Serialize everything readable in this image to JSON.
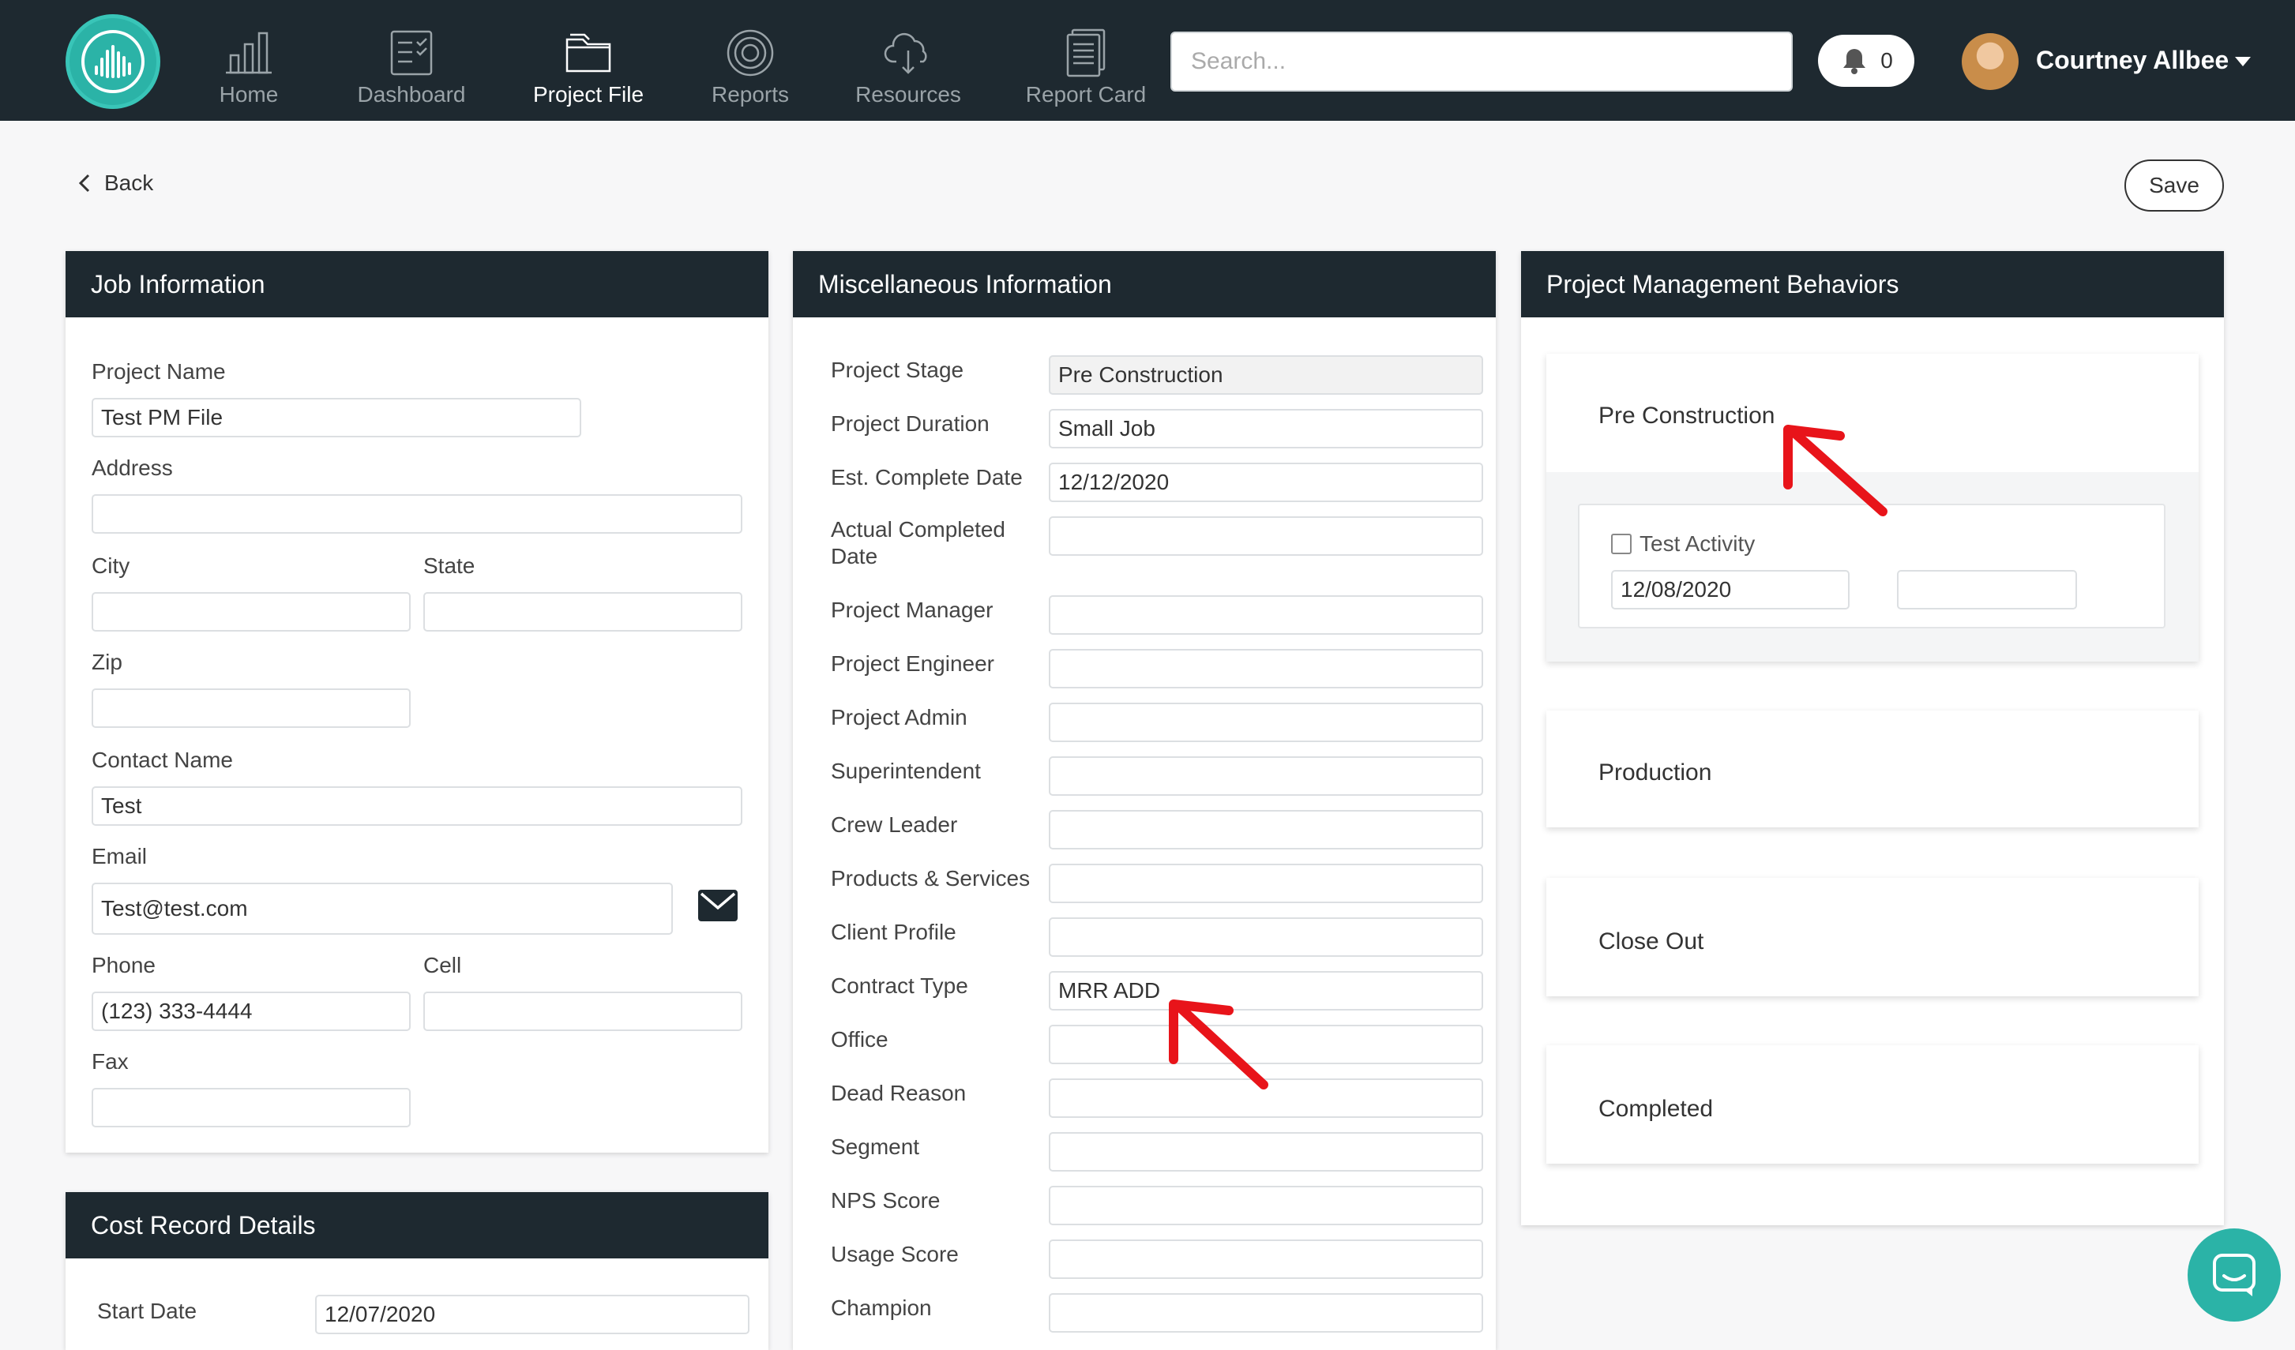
{
  "nav": {
    "items": [
      {
        "label": "Home",
        "icon": "bar-chart-icon"
      },
      {
        "label": "Dashboard",
        "icon": "clipboard-icon"
      },
      {
        "label": "Project File",
        "icon": "folder-icon"
      },
      {
        "label": "Reports",
        "icon": "target-icon"
      },
      {
        "label": "Resources",
        "icon": "cloud-download-icon"
      },
      {
        "label": "Report Card",
        "icon": "document-icon"
      }
    ],
    "active": "Project File",
    "search_placeholder": "Search...",
    "notifications_count": "0",
    "user_name": "Courtney Allbee"
  },
  "toolbar": {
    "back_label": "Back",
    "save_label": "Save"
  },
  "job_information": {
    "title": "Job Information",
    "project_name_label": "Project Name",
    "project_name_value": "Test PM File",
    "address_label": "Address",
    "address_value": "",
    "city_label": "City",
    "city_value": "",
    "state_label": "State",
    "state_value": "",
    "zip_label": "Zip",
    "zip_value": "",
    "contact_name_label": "Contact Name",
    "contact_name_value": "Test",
    "email_label": "Email",
    "email_value": "Test@test.com",
    "phone_label": "Phone",
    "phone_value": "(123) 333-4444",
    "cell_label": "Cell",
    "cell_value": "",
    "fax_label": "Fax",
    "fax_value": ""
  },
  "cost_record": {
    "title": "Cost Record Details",
    "start_date_label": "Start Date",
    "start_date_value": "12/07/2020"
  },
  "misc_information": {
    "title": "Miscellaneous Information",
    "fields": [
      {
        "label": "Project Stage",
        "value": "Pre Construction"
      },
      {
        "label": "Project Duration",
        "value": "Small Job"
      },
      {
        "label": "Est. Complete Date",
        "value": "12/12/2020"
      },
      {
        "label": "Actual Completed Date",
        "value": ""
      },
      {
        "label": "Project Manager",
        "value": ""
      },
      {
        "label": "Project Engineer",
        "value": ""
      },
      {
        "label": "Project Admin",
        "value": ""
      },
      {
        "label": "Superintendent",
        "value": ""
      },
      {
        "label": "Crew Leader",
        "value": ""
      },
      {
        "label": "Products & Services",
        "value": ""
      },
      {
        "label": "Client Profile",
        "value": ""
      },
      {
        "label": "Contract Type",
        "value": "MRR ADD"
      },
      {
        "label": "Office",
        "value": ""
      },
      {
        "label": "Dead Reason",
        "value": ""
      },
      {
        "label": "Segment",
        "value": ""
      },
      {
        "label": "NPS Score",
        "value": ""
      },
      {
        "label": "Usage Score",
        "value": ""
      },
      {
        "label": "Champion",
        "value": ""
      }
    ]
  },
  "pm_behaviors": {
    "title": "Project Management Behaviors",
    "stages": [
      {
        "name": "Pre Construction"
      },
      {
        "name": "Production"
      },
      {
        "name": "Close Out"
      },
      {
        "name": "Completed"
      }
    ],
    "activity": {
      "label": "Test Activity",
      "checked": false,
      "date_value": "12/08/2020",
      "second_value": ""
    }
  },
  "colors": {
    "nav_bg": "#1e2930",
    "accent": "#2bb3a7",
    "annotation_arrow": "#e8141a"
  }
}
